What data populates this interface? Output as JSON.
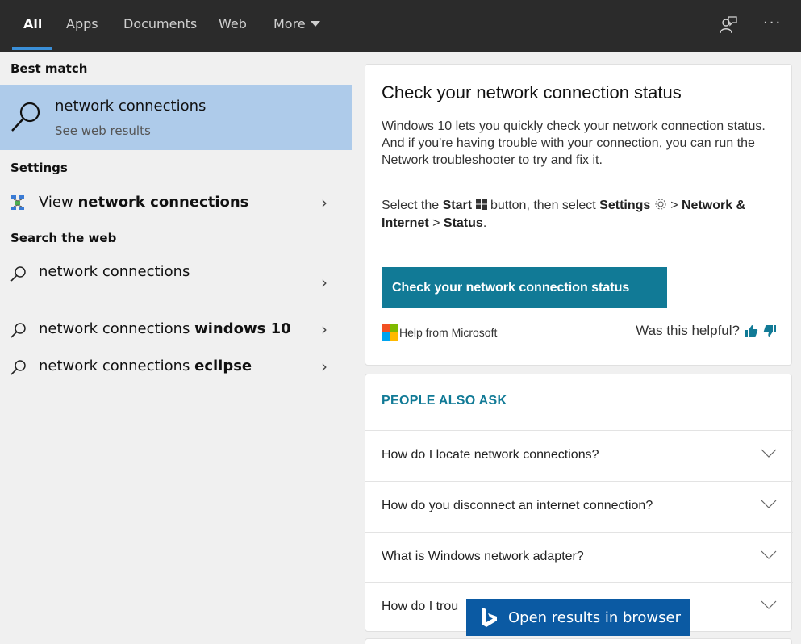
{
  "tabs": [
    {
      "label": "All",
      "active": true
    },
    {
      "label": "Apps"
    },
    {
      "label": "Documents"
    },
    {
      "label": "Web"
    },
    {
      "label": "More"
    }
  ],
  "icons": {
    "feedback": "feedback-icon",
    "more": "ellipsis-icon"
  },
  "left": {
    "best_match_heading": "Best match",
    "best_match": {
      "title": "network connections",
      "subtitle": "See web results"
    },
    "settings_heading": "Settings",
    "settings_item": {
      "prefix": "View ",
      "bold": "network connections"
    },
    "web_heading": "Search the web",
    "web_items": [
      {
        "text": "network connections",
        "bold": ""
      },
      {
        "text": "network connections ",
        "bold": "windows 10"
      },
      {
        "text": "network connections ",
        "bold": "eclipse"
      }
    ]
  },
  "answer": {
    "title": "Check your network connection status",
    "body": "Windows 10 lets you quickly check your network connection status. And if you're having trouble with your connection, you can run the Network troubleshooter to try and fix it.",
    "steps": {
      "t1": "Select the ",
      "b1": "Start",
      "t2": " button, then select ",
      "b2": "Settings",
      "t3": " > ",
      "b3": "Network & Internet",
      "t4": " > ",
      "b4": "Status",
      "t5": "."
    },
    "cta": "Check your network connection status",
    "source": "Help from Microsoft",
    "helpful": "Was this helpful?"
  },
  "paa": {
    "heading": "PEOPLE ALSO ASK",
    "questions": [
      "How do I locate network connections?",
      "How do you disconnect an internet connection?",
      "What is Windows network adapter?",
      "How do I trou"
    ]
  },
  "open_browser": "Open results in browser",
  "colors": {
    "accent": "#117a96",
    "selection": "#aecbea",
    "topbar": "#2b2b2b",
    "open_button": "#0b5aa3"
  }
}
